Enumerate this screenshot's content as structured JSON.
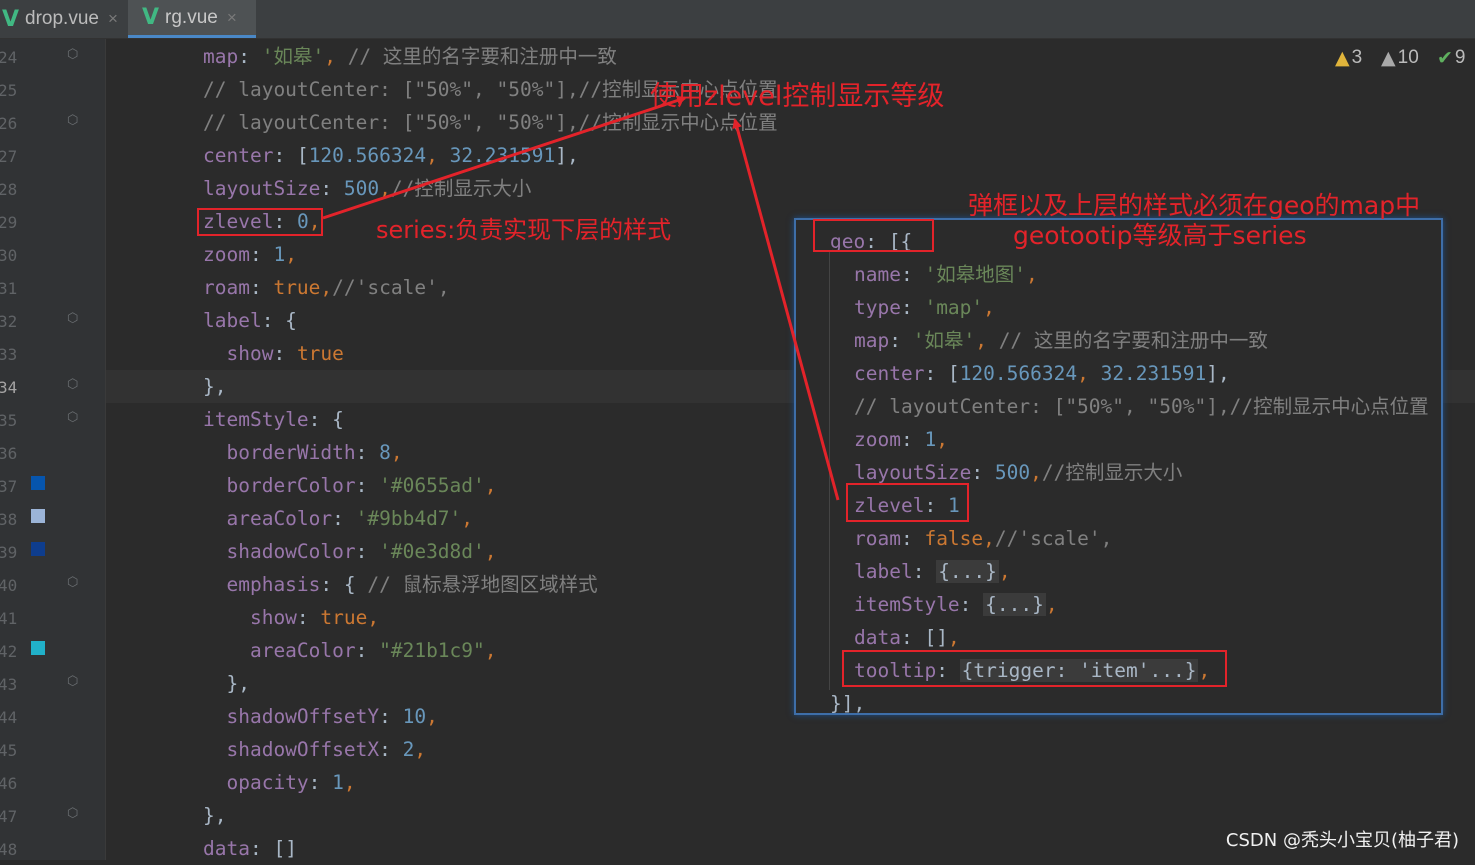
{
  "tabs": [
    {
      "label": "drop.vue",
      "close": "×",
      "icon": "vue-icon"
    },
    {
      "label": "rg.vue",
      "close": "×",
      "icon": "vue-icon"
    }
  ],
  "inspections": {
    "warnings": "3",
    "weak_warnings": "10",
    "typos": "9"
  },
  "line_numbers": [
    "24",
    "25",
    "26",
    "27",
    "28",
    "29",
    "30",
    "31",
    "32",
    "33",
    "34",
    "35",
    "36",
    "37",
    "38",
    "39",
    "40",
    "41",
    "42",
    "43",
    "44",
    "45",
    "46",
    "47",
    "48"
  ],
  "code_lines": [
    [
      {
        "t": "map",
        "c": "k"
      },
      {
        "t": ": ",
        "c": "p"
      },
      {
        "t": "'如皋'",
        "c": "s"
      },
      {
        "t": ", ",
        "c": "b"
      },
      {
        "t": "// 这里的名字要和注册中一致",
        "c": "c"
      }
    ],
    [
      {
        "t": "// layoutCenter: [\"50%\", \"50%\"],//控制显示中心点位置",
        "c": "c"
      }
    ],
    [
      {
        "t": "// layoutCenter: [\"50%\", \"50%\"],//控制显示中心点位置",
        "c": "c"
      }
    ],
    [
      {
        "t": "center",
        "c": "k"
      },
      {
        "t": ": [",
        "c": "p"
      },
      {
        "t": "120.566324",
        "c": "n"
      },
      {
        "t": ", ",
        "c": "b"
      },
      {
        "t": "32.231591",
        "c": "n"
      },
      {
        "t": "],",
        "c": "p"
      }
    ],
    [
      {
        "t": "layoutSize",
        "c": "k"
      },
      {
        "t": ": ",
        "c": "p"
      },
      {
        "t": "500",
        "c": "n"
      },
      {
        "t": ",",
        "c": "b"
      },
      {
        "t": "//控制显示大小",
        "c": "c"
      }
    ],
    [
      {
        "t": "zlevel",
        "c": "k"
      },
      {
        "t": ": ",
        "c": "p"
      },
      {
        "t": "0",
        "c": "n"
      },
      {
        "t": ",",
        "c": "b"
      }
    ],
    [
      {
        "t": "zoom",
        "c": "k"
      },
      {
        "t": ": ",
        "c": "p"
      },
      {
        "t": "1",
        "c": "n"
      },
      {
        "t": ",",
        "c": "b"
      }
    ],
    [
      {
        "t": "roam",
        "c": "k"
      },
      {
        "t": ": ",
        "c": "p"
      },
      {
        "t": "true",
        "c": "b"
      },
      {
        "t": ",",
        "c": "b"
      },
      {
        "t": "//'scale',",
        "c": "c"
      }
    ],
    [
      {
        "t": "label",
        "c": "k"
      },
      {
        "t": ": {",
        "c": "p"
      }
    ],
    [
      {
        "t": "  show",
        "c": "k"
      },
      {
        "t": ": ",
        "c": "p"
      },
      {
        "t": "true",
        "c": "b"
      }
    ],
    [
      {
        "t": "},",
        "c": "p"
      }
    ],
    [
      {
        "t": "itemStyle",
        "c": "k"
      },
      {
        "t": ": {",
        "c": "p"
      }
    ],
    [
      {
        "t": "  borderWidth",
        "c": "k"
      },
      {
        "t": ": ",
        "c": "p"
      },
      {
        "t": "8",
        "c": "n"
      },
      {
        "t": ",",
        "c": "b"
      }
    ],
    [
      {
        "t": "  borderColor",
        "c": "k"
      },
      {
        "t": ": ",
        "c": "p"
      },
      {
        "t": "'#0655ad'",
        "c": "s"
      },
      {
        "t": ",",
        "c": "b"
      }
    ],
    [
      {
        "t": "  areaColor",
        "c": "k"
      },
      {
        "t": ": ",
        "c": "p"
      },
      {
        "t": "'#9bb4d7'",
        "c": "s"
      },
      {
        "t": ",",
        "c": "b"
      }
    ],
    [
      {
        "t": "  shadowColor",
        "c": "k"
      },
      {
        "t": ": ",
        "c": "p"
      },
      {
        "t": "'#0e3d8d'",
        "c": "s"
      },
      {
        "t": ",",
        "c": "b"
      }
    ],
    [
      {
        "t": "  emphasis",
        "c": "k"
      },
      {
        "t": ": { ",
        "c": "p"
      },
      {
        "t": "// 鼠标悬浮地图区域样式",
        "c": "c"
      }
    ],
    [
      {
        "t": "    show",
        "c": "k"
      },
      {
        "t": ": ",
        "c": "p"
      },
      {
        "t": "true",
        "c": "b"
      },
      {
        "t": ",",
        "c": "b"
      }
    ],
    [
      {
        "t": "    areaColor",
        "c": "k"
      },
      {
        "t": ": ",
        "c": "p"
      },
      {
        "t": "\"#21b1c9\"",
        "c": "s"
      },
      {
        "t": ",",
        "c": "b"
      }
    ],
    [
      {
        "t": "  },",
        "c": "p"
      }
    ],
    [
      {
        "t": "  shadowOffsetY",
        "c": "k"
      },
      {
        "t": ": ",
        "c": "p"
      },
      {
        "t": "10",
        "c": "n"
      },
      {
        "t": ",",
        "c": "b"
      }
    ],
    [
      {
        "t": "  shadowOffsetX",
        "c": "k"
      },
      {
        "t": ": ",
        "c": "p"
      },
      {
        "t": "2",
        "c": "n"
      },
      {
        "t": ",",
        "c": "b"
      }
    ],
    [
      {
        "t": "  opacity",
        "c": "k"
      },
      {
        "t": ": ",
        "c": "p"
      },
      {
        "t": "1",
        "c": "n"
      },
      {
        "t": ",",
        "c": "b"
      }
    ],
    [
      {
        "t": "},",
        "c": "p"
      }
    ],
    [
      {
        "t": "data",
        "c": "k"
      },
      {
        "t": ": []",
        "c": "p"
      }
    ]
  ],
  "swatches": [
    {
      "line": 13,
      "color": "#0655ad"
    },
    {
      "line": 14,
      "color": "#9bb4d7"
    },
    {
      "line": 15,
      "color": "#0e3d8d"
    },
    {
      "line": 18,
      "color": "#21b1c9"
    }
  ],
  "panel_lines": [
    {
      "indent": 0,
      "parts": [
        {
          "t": "geo",
          "c": "k"
        },
        {
          "t": ": [{",
          "c": "p"
        }
      ]
    },
    {
      "indent": 1,
      "parts": [
        {
          "t": "name",
          "c": "k"
        },
        {
          "t": ": ",
          "c": "p"
        },
        {
          "t": "'如皋地图'",
          "c": "s"
        },
        {
          "t": ",",
          "c": "b"
        }
      ]
    },
    {
      "indent": 1,
      "parts": [
        {
          "t": "type",
          "c": "k"
        },
        {
          "t": ": ",
          "c": "p"
        },
        {
          "t": "'map'",
          "c": "s"
        },
        {
          "t": ",",
          "c": "b"
        }
      ]
    },
    {
      "indent": 1,
      "parts": [
        {
          "t": "map",
          "c": "k"
        },
        {
          "t": ": ",
          "c": "p"
        },
        {
          "t": "'如皋'",
          "c": "s"
        },
        {
          "t": ", ",
          "c": "b"
        },
        {
          "t": "// 这里的名字要和注册中一致",
          "c": "c"
        }
      ]
    },
    {
      "indent": 1,
      "parts": [
        {
          "t": "center",
          "c": "k"
        },
        {
          "t": ": [",
          "c": "p"
        },
        {
          "t": "120.566324",
          "c": "n"
        },
        {
          "t": ", ",
          "c": "b"
        },
        {
          "t": "32.231591",
          "c": "n"
        },
        {
          "t": "],",
          "c": "p"
        }
      ]
    },
    {
      "indent": 1,
      "parts": [
        {
          "t": "// layoutCenter: [\"50%\", \"50%\"],//控制显示中心点位置",
          "c": "c"
        }
      ]
    },
    {
      "indent": 1,
      "parts": [
        {
          "t": "zoom",
          "c": "k"
        },
        {
          "t": ": ",
          "c": "p"
        },
        {
          "t": "1",
          "c": "n"
        },
        {
          "t": ",",
          "c": "b"
        }
      ]
    },
    {
      "indent": 1,
      "parts": [
        {
          "t": "layoutSize",
          "c": "k"
        },
        {
          "t": ": ",
          "c": "p"
        },
        {
          "t": "500",
          "c": "n"
        },
        {
          "t": ",",
          "c": "b"
        },
        {
          "t": "//控制显示大小",
          "c": "c"
        }
      ]
    },
    {
      "indent": 1,
      "parts": [
        {
          "t": "zlevel",
          "c": "k"
        },
        {
          "t": ": ",
          "c": "p"
        },
        {
          "t": "1",
          "c": "n"
        }
      ]
    },
    {
      "indent": 1,
      "parts": [
        {
          "t": "roam",
          "c": "k"
        },
        {
          "t": ": ",
          "c": "p"
        },
        {
          "t": "false",
          "c": "b"
        },
        {
          "t": ",",
          "c": "b"
        },
        {
          "t": "//'scale',",
          "c": "c"
        }
      ]
    },
    {
      "indent": 1,
      "parts": [
        {
          "t": "label",
          "c": "k"
        },
        {
          "t": ": ",
          "c": "p"
        },
        {
          "t": "{...}",
          "c": "f"
        },
        {
          "t": ",",
          "c": "b"
        }
      ]
    },
    {
      "indent": 1,
      "parts": [
        {
          "t": "itemStyle",
          "c": "k"
        },
        {
          "t": ": ",
          "c": "p"
        },
        {
          "t": "{...}",
          "c": "f"
        },
        {
          "t": ",",
          "c": "b"
        }
      ]
    },
    {
      "indent": 1,
      "parts": [
        {
          "t": "data",
          "c": "k"
        },
        {
          "t": ": []",
          "c": "p"
        },
        {
          "t": ",",
          "c": "b"
        }
      ]
    },
    {
      "indent": 1,
      "parts": [
        {
          "t": "tooltip",
          "c": "k"
        },
        {
          "t": ": ",
          "c": "p"
        },
        {
          "t": "{trigger: 'item'...}",
          "c": "f"
        },
        {
          "t": ",",
          "c": "b"
        }
      ]
    },
    {
      "indent": 0,
      "parts": [
        {
          "t": "}],",
          "c": "p"
        }
      ]
    }
  ],
  "annotations": {
    "zlevel_control": "使用zlevel控制显示等级",
    "series_desc": "series:负责实现下层的样式",
    "geo_desc_line1": "弹框以及上层的样式必须在geo的map中",
    "geo_desc_line2": "geotootip等级高于series"
  },
  "watermark": "CSDN @秃头小宝贝(柚子君)",
  "colors": {
    "annotation_red": "#e3232a",
    "panel_border": "#3e6ea8",
    "editor_bg": "#2b2b2b"
  }
}
